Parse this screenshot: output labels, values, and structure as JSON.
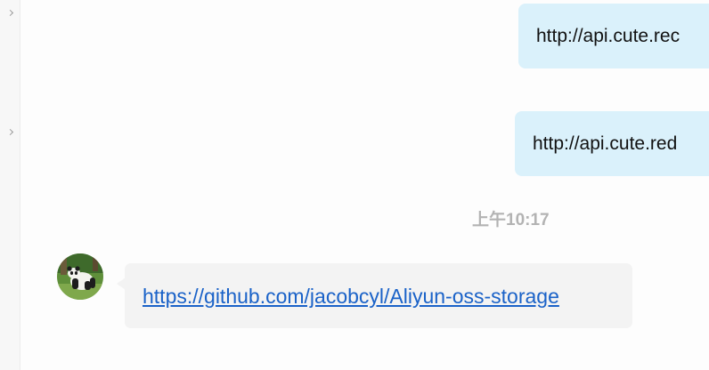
{
  "messages": {
    "outgoing_1": {
      "text": "http://api.cute.rec"
    },
    "outgoing_2": {
      "text": "http://api.cute.red"
    },
    "timestamp": "上午10:17",
    "incoming_1": {
      "link": "https://github.com/jacobcyl/Aliyun-oss-storage"
    }
  },
  "colors": {
    "outgoing_bubble": "#daf1fb",
    "incoming_bubble": "#f3f3f3",
    "link": "#1a62c8",
    "timestamp": "#b3b3b3"
  },
  "icons": {
    "avatar": "panda-avatar"
  }
}
